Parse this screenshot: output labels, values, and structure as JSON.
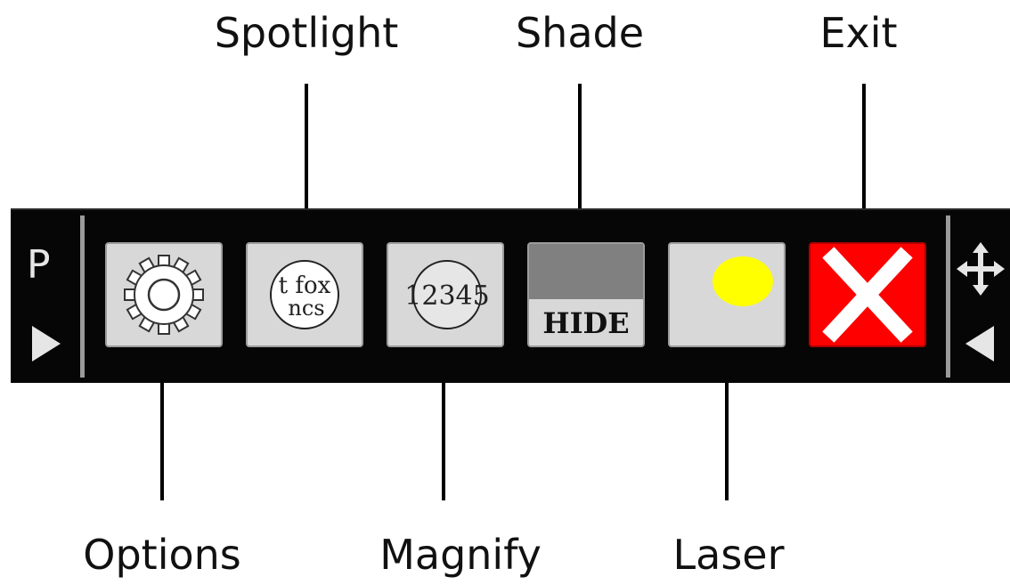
{
  "labels": {
    "spotlight": "Spotlight",
    "shade": "Shade",
    "exit": "Exit",
    "options": "Options",
    "magnify": "Magnify",
    "laser": "Laser"
  },
  "toolbar": {
    "pin_letter": "P",
    "spotlight_text_top": "t fox",
    "spotlight_text_bottom": "ncs",
    "magnify_text": "12345",
    "shade_text": "HIDE"
  },
  "colors": {
    "exit_bg": "#ff0000",
    "laser_dot": "#ffff00",
    "shade_bar": "#808080"
  },
  "icons": [
    "gear-icon",
    "spotlight-icon",
    "magnify-icon",
    "shade-icon",
    "laser-dot-icon",
    "close-icon",
    "move-icon"
  ]
}
